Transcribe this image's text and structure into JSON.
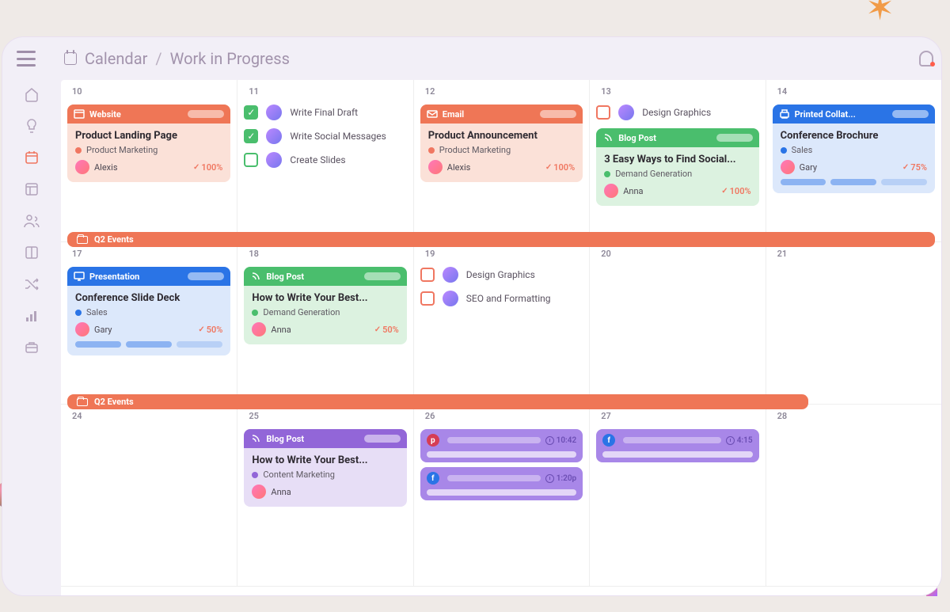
{
  "breadcrumb": {
    "root": "Calendar",
    "sep": "/",
    "current": "Work in Progress"
  },
  "events_label": "Q2 Events",
  "cells": {
    "r0": [
      {
        "day": "10",
        "card": {
          "kind": "website",
          "head": "Website",
          "title": "Product Landing Page",
          "tag": "Product Marketing",
          "tagcolor": "#f07761",
          "assignee": "Alexis",
          "pct": "100%"
        }
      },
      {
        "day": "11",
        "tasks": [
          {
            "done": true,
            "label": "Write Final Draft"
          },
          {
            "done": true,
            "label": "Write Social Messages"
          },
          {
            "done": false,
            "label": "Create Slides"
          }
        ]
      },
      {
        "day": "12",
        "card": {
          "kind": "email",
          "head": "Email",
          "title": "Product Announcement",
          "tag": "Product Marketing",
          "tagcolor": "#f07761",
          "assignee": "Alexis",
          "pct": "100%"
        }
      },
      {
        "day": "13",
        "task": {
          "label": "Design Graphics"
        },
        "card": {
          "kind": "blog",
          "head": "Blog Post",
          "title": "3 Easy Ways to Find Social...",
          "tag": "Demand Generation",
          "tagcolor": "#4abe6d",
          "assignee": "Anna",
          "pct": "100%"
        }
      },
      {
        "day": "14",
        "card": {
          "kind": "print",
          "head": "Printed Collat...",
          "title": "Conference Brochure",
          "tag": "Sales",
          "tagcolor": "#2a74e6",
          "assignee": "Gary",
          "pct": "75%",
          "progress": true
        }
      }
    ],
    "r1": [
      {
        "day": "17",
        "card": {
          "kind": "presentation",
          "head": "Presentation",
          "title": "Conference Slide Deck",
          "tag": "Sales",
          "tagcolor": "#2a74e6",
          "assignee": "Gary",
          "pct": "50%",
          "progress": true
        }
      },
      {
        "day": "18",
        "card": {
          "kind": "blog",
          "head": "Blog Post",
          "title": "How to Write Your Best...",
          "tag": "Demand Generation",
          "tagcolor": "#4abe6d",
          "assignee": "Anna",
          "pct": "50%"
        }
      },
      {
        "day": "19",
        "tasks": [
          {
            "red": true,
            "label": "Design Graphics"
          },
          {
            "red": true,
            "label": "SEO and Formatting"
          }
        ]
      },
      {
        "day": "20"
      },
      {
        "day": "21"
      }
    ],
    "r2": [
      {
        "day": "24"
      },
      {
        "day": "25",
        "card": {
          "kind": "blogp",
          "head": "Blog Post",
          "title": "How to Write Your Best...",
          "tag": "Content Marketing",
          "tagcolor": "#9266d8",
          "assignee": "Anna"
        }
      },
      {
        "day": "26",
        "social": [
          {
            "net": "p",
            "netcolor": "#d63d55",
            "time": "10:42"
          },
          {
            "net": "f",
            "netcolor": "#2a74e6",
            "time": "1:20p"
          }
        ]
      },
      {
        "day": "27",
        "social": [
          {
            "net": "f",
            "netcolor": "#2a74e6",
            "time": "4:15"
          }
        ]
      },
      {
        "day": "28"
      }
    ]
  },
  "colors": {
    "website": {
      "head": "#ef7656",
      "body": "#fbe1d8"
    },
    "email": {
      "head": "#ef7656",
      "body": "#fbe1d8"
    },
    "blog": {
      "head": "#4abe6d",
      "body": "#dcf2e0"
    },
    "print": {
      "head": "#2a74e6",
      "body": "#dce8fb"
    },
    "presentation": {
      "head": "#2a74e6",
      "body": "#dce8fb"
    },
    "blogp": {
      "head": "#9266d8",
      "body": "#e7def6"
    }
  }
}
